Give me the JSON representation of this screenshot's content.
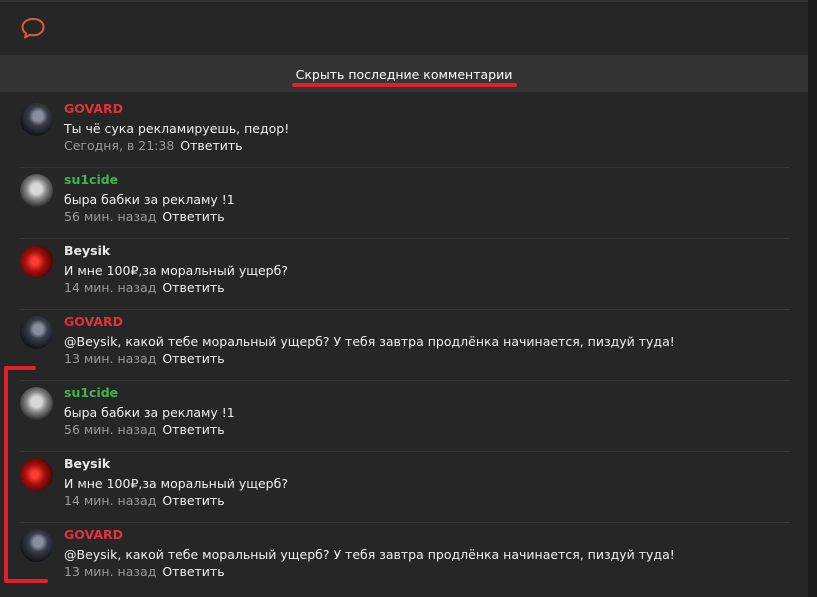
{
  "toggle": {
    "label": "Скрыть последние комментарии"
  },
  "colors": {
    "accent_red": "#e0202a",
    "author_red": "#e4313c",
    "author_green": "#3fb54a"
  },
  "comments": [
    {
      "author": "GOVARD",
      "author_color": "red",
      "text": "Ты чё сука рекламируешь, педор!",
      "time": "Сегодня, в 21:38",
      "reply": "Ответить"
    },
    {
      "author": "su1cide",
      "author_color": "green",
      "text": "быра бабки за рекламу !1",
      "time": "56 мин. назад",
      "reply": "Ответить"
    },
    {
      "author": "Beysik",
      "author_color": "white",
      "text": "И мне 100₽,за моральный ущерб?",
      "time": "14 мин. назад",
      "reply": "Ответить"
    },
    {
      "author": "GOVARD",
      "author_color": "red",
      "text": "@Beysik, какой тебе моральный ущерб? У тебя завтра продлёнка начинается, пиздуй туда!",
      "time": "13 мин. назад",
      "reply": "Ответить"
    },
    {
      "author": "su1cide",
      "author_color": "green",
      "text": "быра бабки за рекламу !1",
      "time": "56 мин. назад",
      "reply": "Ответить"
    },
    {
      "author": "Beysik",
      "author_color": "white",
      "text": "И мне 100₽,за моральный ущерб?",
      "time": "14 мин. назад",
      "reply": "Ответить"
    },
    {
      "author": "GOVARD",
      "author_color": "red",
      "text": "@Beysik, какой тебе моральный ущерб? У тебя завтра продлёнка начинается, пиздуй туда!",
      "time": "13 мин. назад",
      "reply": "Ответить"
    }
  ]
}
